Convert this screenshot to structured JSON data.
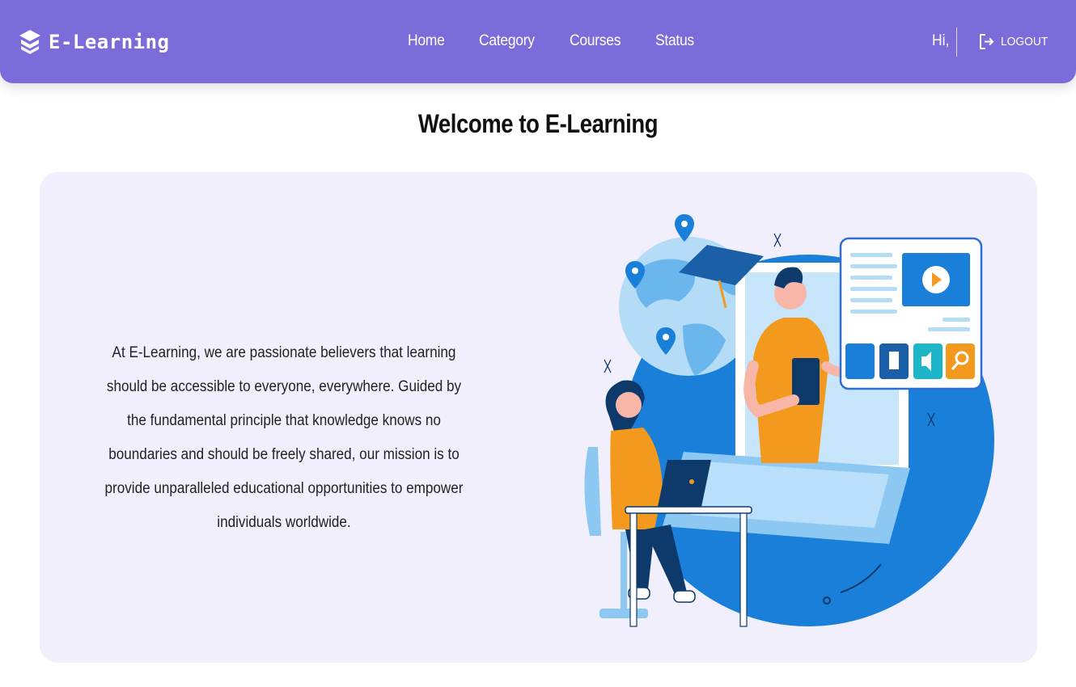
{
  "brand": {
    "name": "E-Learning",
    "icon": "graduation-layers-icon"
  },
  "nav": {
    "home": "Home",
    "category": "Category",
    "courses": "Courses",
    "status": "Status"
  },
  "user": {
    "greeting": "Hi,"
  },
  "logout": {
    "label": "LOGOUT",
    "icon": "logout-icon"
  },
  "main": {
    "title": "Welcome to E-Learning",
    "intro": "At E-Learning, we are passionate believers that learning should be accessible to everyone, everywhere. Guided by the fundamental principle that knowledge knows no boundaries and should be freely shared, our mission is to provide unparalleled educational opportunities to empower individuals worldwide."
  },
  "colors": {
    "navbar": "#7b6cd9",
    "card": "#f0effb",
    "illustration_blue": "#1a7fd8",
    "illustration_orange": "#f39a1e"
  }
}
